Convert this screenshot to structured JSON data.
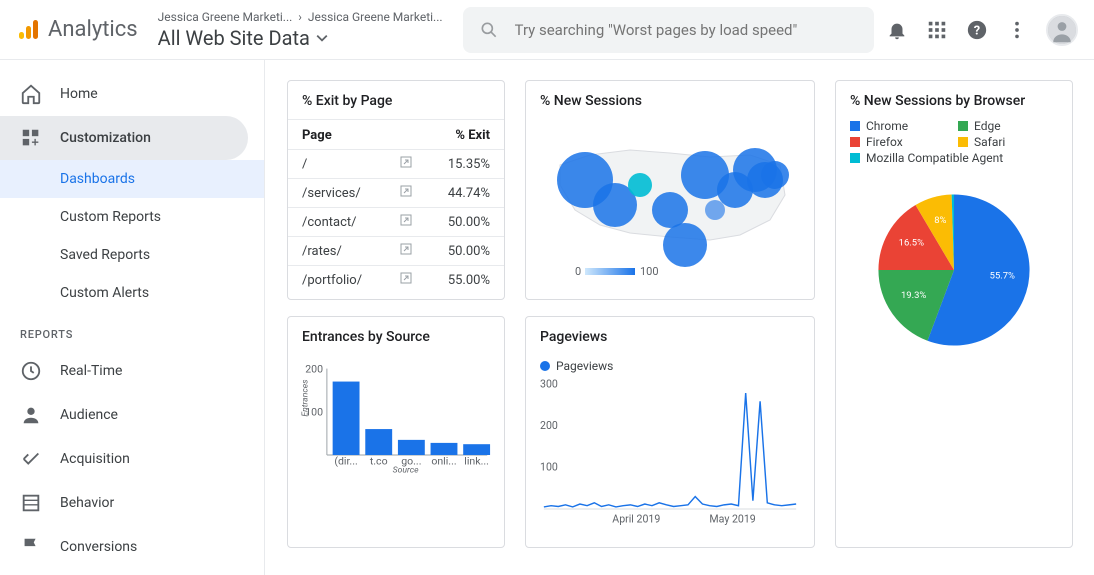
{
  "header": {
    "logo_text": "Analytics",
    "breadcrumb1": "Jessica Greene Marketi...",
    "breadcrumb2": "Jessica Greene Marketi...",
    "property": "All Web Site Data",
    "search_placeholder": "Try searching \"Worst pages by load speed\""
  },
  "sidebar": {
    "home": "Home",
    "customization": "Customization",
    "sub": {
      "dashboards": "Dashboards",
      "custom_reports": "Custom Reports",
      "saved_reports": "Saved Reports",
      "custom_alerts": "Custom Alerts"
    },
    "reports_label": "REPORTS",
    "realtime": "Real-Time",
    "audience": "Audience",
    "acquisition": "Acquisition",
    "behavior": "Behavior",
    "conversions": "Conversions"
  },
  "cards": {
    "exit": {
      "title": "% Exit by Page",
      "col_page": "Page",
      "col_exit": "% Exit",
      "rows": [
        {
          "page": "/",
          "exit": "15.35%"
        },
        {
          "page": "/services/",
          "exit": "44.74%"
        },
        {
          "page": "/contact/",
          "exit": "50.00%"
        },
        {
          "page": "/rates/",
          "exit": "50.00%"
        },
        {
          "page": "/portfolio/",
          "exit": "55.00%"
        }
      ]
    },
    "map": {
      "title": "% New Sessions",
      "scale_min": "0",
      "scale_max": "100"
    },
    "entrances": {
      "title": "Entrances by Source"
    },
    "pageviews": {
      "title": "Pageviews",
      "legend": "Pageviews",
      "x1": "April 2019",
      "x2": "May 2019",
      "y_ticks": [
        "100",
        "200",
        "300"
      ]
    },
    "browser": {
      "title": "% New Sessions by Browser",
      "legend": [
        {
          "name": "Chrome",
          "color": "#1a73e8"
        },
        {
          "name": "Edge",
          "color": "#34a853"
        },
        {
          "name": "Firefox",
          "color": "#ea4335"
        },
        {
          "name": "Safari",
          "color": "#fbbc04"
        },
        {
          "name": "Mozilla Compatible Agent",
          "color": "#00bcd4"
        }
      ]
    }
  },
  "chart_data": [
    {
      "type": "table",
      "title": "% Exit by Page",
      "columns": [
        "Page",
        "% Exit"
      ],
      "rows": [
        [
          "/",
          15.35
        ],
        [
          "/services/",
          44.74
        ],
        [
          "/contact/",
          50.0
        ],
        [
          "/rates/",
          50.0
        ],
        [
          "/portfolio/",
          55.0
        ]
      ]
    },
    {
      "type": "bar",
      "title": "Entrances by Source",
      "xlabel": "Source",
      "ylabel": "Entrances",
      "ylim": [
        0,
        200
      ],
      "categories": [
        "(dir...",
        "t.co",
        "go...",
        "onli...",
        "link..."
      ],
      "values": [
        170,
        60,
        35,
        28,
        25
      ]
    },
    {
      "type": "line",
      "title": "Pageviews",
      "xlabel": "",
      "ylabel": "",
      "ylim": [
        0,
        300
      ],
      "x_labels": [
        "April 2019",
        "May 2019"
      ],
      "series": [
        {
          "name": "Pageviews",
          "values": [
            5,
            8,
            6,
            10,
            5,
            12,
            8,
            15,
            6,
            10,
            5,
            8,
            10,
            6,
            12,
            8,
            15,
            10,
            6,
            8,
            10,
            30,
            12,
            8,
            6,
            10,
            12,
            8,
            280,
            20,
            260,
            15,
            10,
            8,
            10,
            12
          ]
        }
      ]
    },
    {
      "type": "pie",
      "title": "% New Sessions by Browser",
      "series": [
        {
          "name": "Chrome",
          "value": 55.7,
          "color": "#1a73e8"
        },
        {
          "name": "Edge",
          "value": 19.3,
          "color": "#34a853"
        },
        {
          "name": "Firefox",
          "value": 16.5,
          "color": "#ea4335"
        },
        {
          "name": "Safari",
          "value": 8.0,
          "color": "#fbbc04"
        },
        {
          "name": "Mozilla Compatible Agent",
          "value": 0.5,
          "color": "#00bcd4"
        }
      ]
    },
    {
      "type": "map",
      "title": "% New Sessions",
      "region": "United States",
      "metric": "% New Sessions",
      "scale": [
        0,
        100
      ]
    }
  ]
}
